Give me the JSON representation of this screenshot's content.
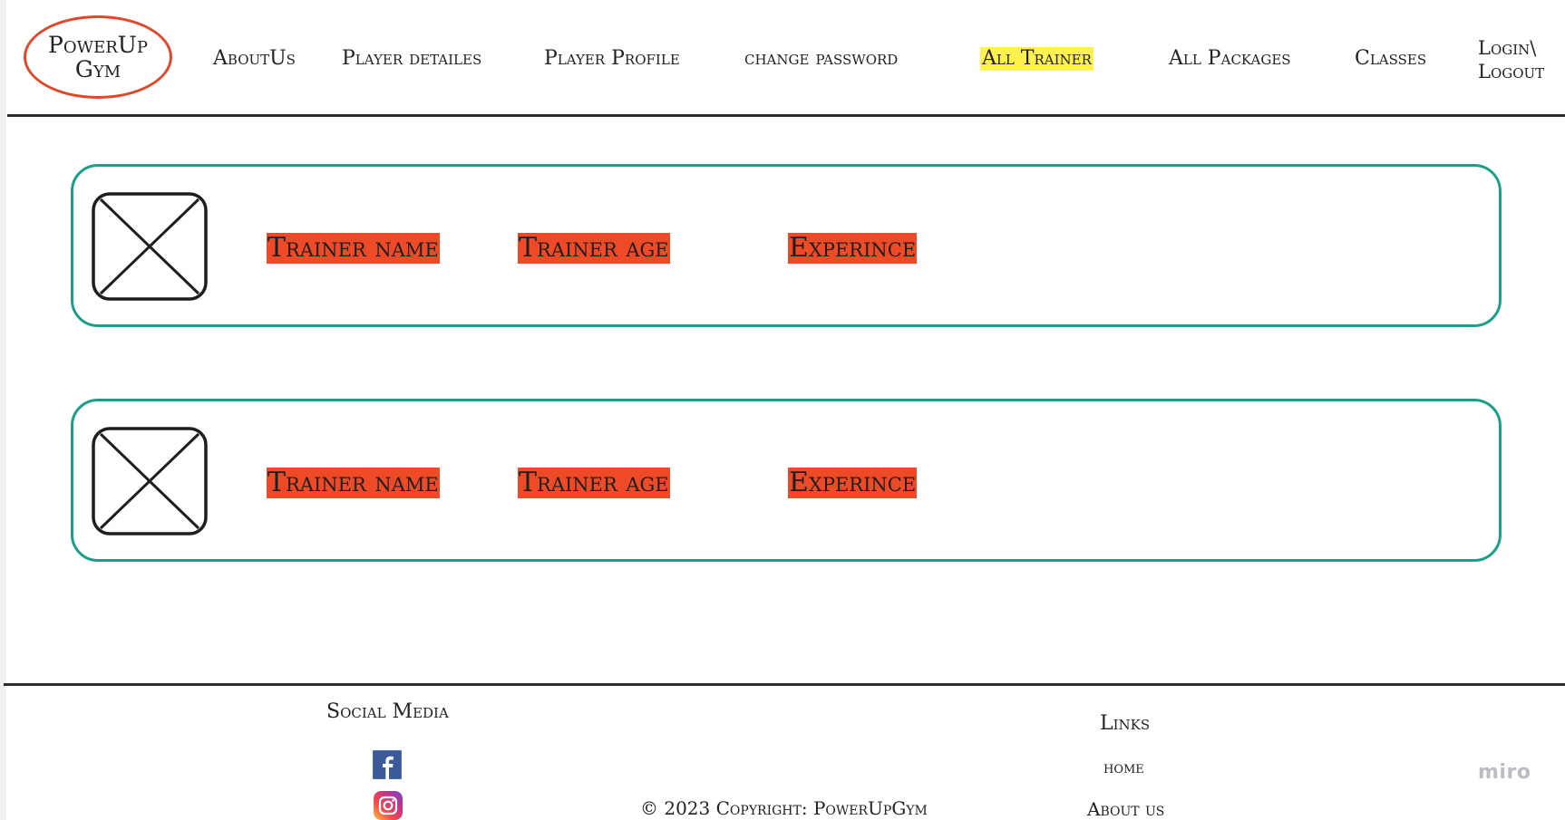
{
  "header": {
    "logo_line1": "PowerUp",
    "logo_line2": "Gym",
    "nav": {
      "about_us": "AboutUs",
      "player_details": "Player detailes",
      "player_profile": "Player Profile",
      "change_password": "change password",
      "all_trainer": "All Trainer",
      "all_packages": "All Packages",
      "classes": "Classes",
      "login_line1": "Login\\",
      "login_line2": "Logout"
    },
    "active_item": "All Trainer",
    "colors": {
      "active_highlight": "#fef150",
      "logo_ring": "#e0482a"
    }
  },
  "trainers": [
    {
      "name_label": "Trainer name",
      "age_label": "Trainer age",
      "experience_label": "Experince",
      "photo_icon": "image-placeholder-icon"
    },
    {
      "name_label": "Trainer name",
      "age_label": "Trainer age",
      "experience_label": "Experince",
      "photo_icon": "image-placeholder-icon"
    }
  ],
  "card_colors": {
    "border": "#1aa08a",
    "field_background": "#ef4a27"
  },
  "footer": {
    "social_title": "Social Media",
    "social_icons": [
      "facebook-icon",
      "instagram-icon"
    ],
    "copyright": "© 2023 Copyright: PowerUpGym",
    "links_title": "Links",
    "links": {
      "home": "home",
      "about_us": "About us"
    }
  },
  "watermark": "miro"
}
